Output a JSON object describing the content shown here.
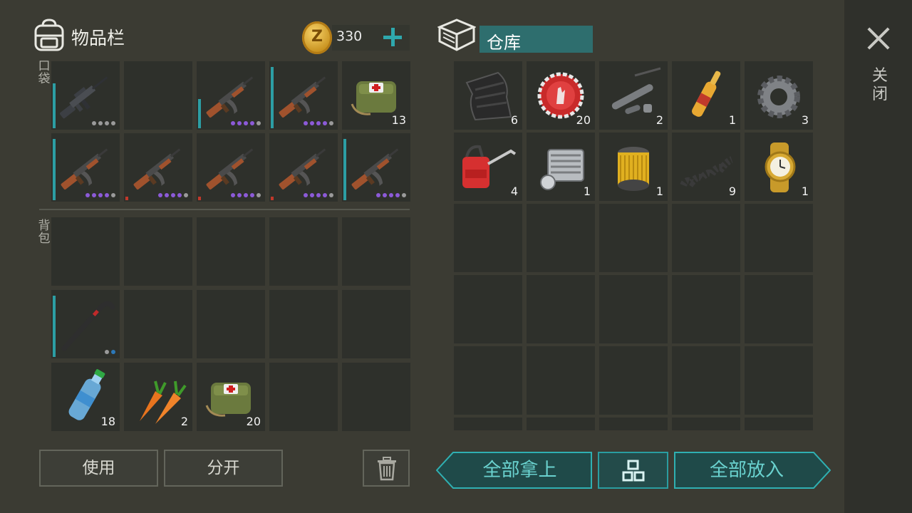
{
  "inventory": {
    "title": "物品栏",
    "coins": "330",
    "pocket_label": "口袋",
    "backpack_label": "背包",
    "use_button": "使用",
    "split_button": "分开",
    "pocket_slots": [
      {
        "icon": "m16-rifle-icon",
        "count": "",
        "bar": 0.7,
        "dots": [
          "#9a9a9a",
          "#9a9a9a",
          "#9a9a9a",
          "#9a9a9a"
        ]
      },
      {
        "icon": "",
        "count": ""
      },
      {
        "icon": "ak47-rifle-icon",
        "count": "",
        "bar": 0.45,
        "dots": [
          "#8c5ad8",
          "#8c5ad8",
          "#8c5ad8",
          "#8c5ad8",
          "#9a9a9a"
        ]
      },
      {
        "icon": "ak47-rifle-icon",
        "count": "",
        "bar": 0.95,
        "dots": [
          "#8c5ad8",
          "#8c5ad8",
          "#8c5ad8",
          "#8c5ad8",
          "#9a9a9a"
        ]
      },
      {
        "icon": "medkit-bag-icon",
        "count": "13"
      },
      {
        "icon": "ak47-rifle-icon",
        "count": "",
        "bar": 0.95,
        "dots": [
          "#8c5ad8",
          "#8c5ad8",
          "#8c5ad8",
          "#8c5ad8",
          "#9a9a9a"
        ]
      },
      {
        "icon": "ak47-rifle-icon",
        "count": "",
        "bar": 0.05,
        "dots": [
          "#8c5ad8",
          "#8c5ad8",
          "#8c5ad8",
          "#8c5ad8",
          "#9a9a9a"
        ]
      },
      {
        "icon": "ak47-rifle-icon",
        "count": "",
        "bar": 0.05,
        "dots": [
          "#8c5ad8",
          "#8c5ad8",
          "#8c5ad8",
          "#8c5ad8",
          "#9a9a9a"
        ]
      },
      {
        "icon": "ak47-rifle-icon",
        "count": "",
        "bar": 0.05,
        "dots": [
          "#8c5ad8",
          "#8c5ad8",
          "#8c5ad8",
          "#8c5ad8",
          "#9a9a9a"
        ]
      },
      {
        "icon": "ak47-rifle-icon",
        "count": "",
        "bar": 0.95,
        "dots": [
          "#8c5ad8",
          "#8c5ad8",
          "#8c5ad8",
          "#8c5ad8",
          "#9a9a9a"
        ]
      }
    ],
    "backpack_slots": [
      {
        "icon": "",
        "count": ""
      },
      {
        "icon": "",
        "count": ""
      },
      {
        "icon": "",
        "count": ""
      },
      {
        "icon": "",
        "count": ""
      },
      {
        "icon": "",
        "count": ""
      },
      {
        "icon": "crowbar-icon",
        "count": "",
        "bar": 0.95,
        "dots": [
          "#9a9a9a",
          "#2c78b8"
        ]
      },
      {
        "icon": "",
        "count": ""
      },
      {
        "icon": "",
        "count": ""
      },
      {
        "icon": "",
        "count": ""
      },
      {
        "icon": "",
        "count": ""
      },
      {
        "icon": "water-bottle-icon",
        "count": "18"
      },
      {
        "icon": "carrot-icon",
        "count": "2"
      },
      {
        "icon": "medkit-bag-icon",
        "count": "20"
      },
      {
        "icon": "",
        "count": ""
      },
      {
        "icon": "",
        "count": ""
      }
    ]
  },
  "storage": {
    "title": "仓库",
    "take_all": "全部拿上",
    "put_all": "全部放入",
    "slots": [
      {
        "icon": "fabric-icon",
        "count": "6"
      },
      {
        "icon": "bottle-cap-icon",
        "count": "20"
      },
      {
        "icon": "gun-parts-icon",
        "count": "2"
      },
      {
        "icon": "ampoule-icon",
        "count": "1"
      },
      {
        "icon": "gear-icon",
        "count": "3"
      },
      {
        "icon": "oil-can-icon",
        "count": "4"
      },
      {
        "icon": "engine-cylinder-icon",
        "count": "1"
      },
      {
        "icon": "oil-filter-icon",
        "count": "1"
      },
      {
        "icon": "spring-icon",
        "count": "9"
      },
      {
        "icon": "gold-watch-icon",
        "count": "1"
      }
    ]
  },
  "close_label": "关闭",
  "colors": {
    "accent": "#2ea8ad",
    "rarity_purple": "#8c5ad8",
    "slot_bg": "#2e302b"
  }
}
